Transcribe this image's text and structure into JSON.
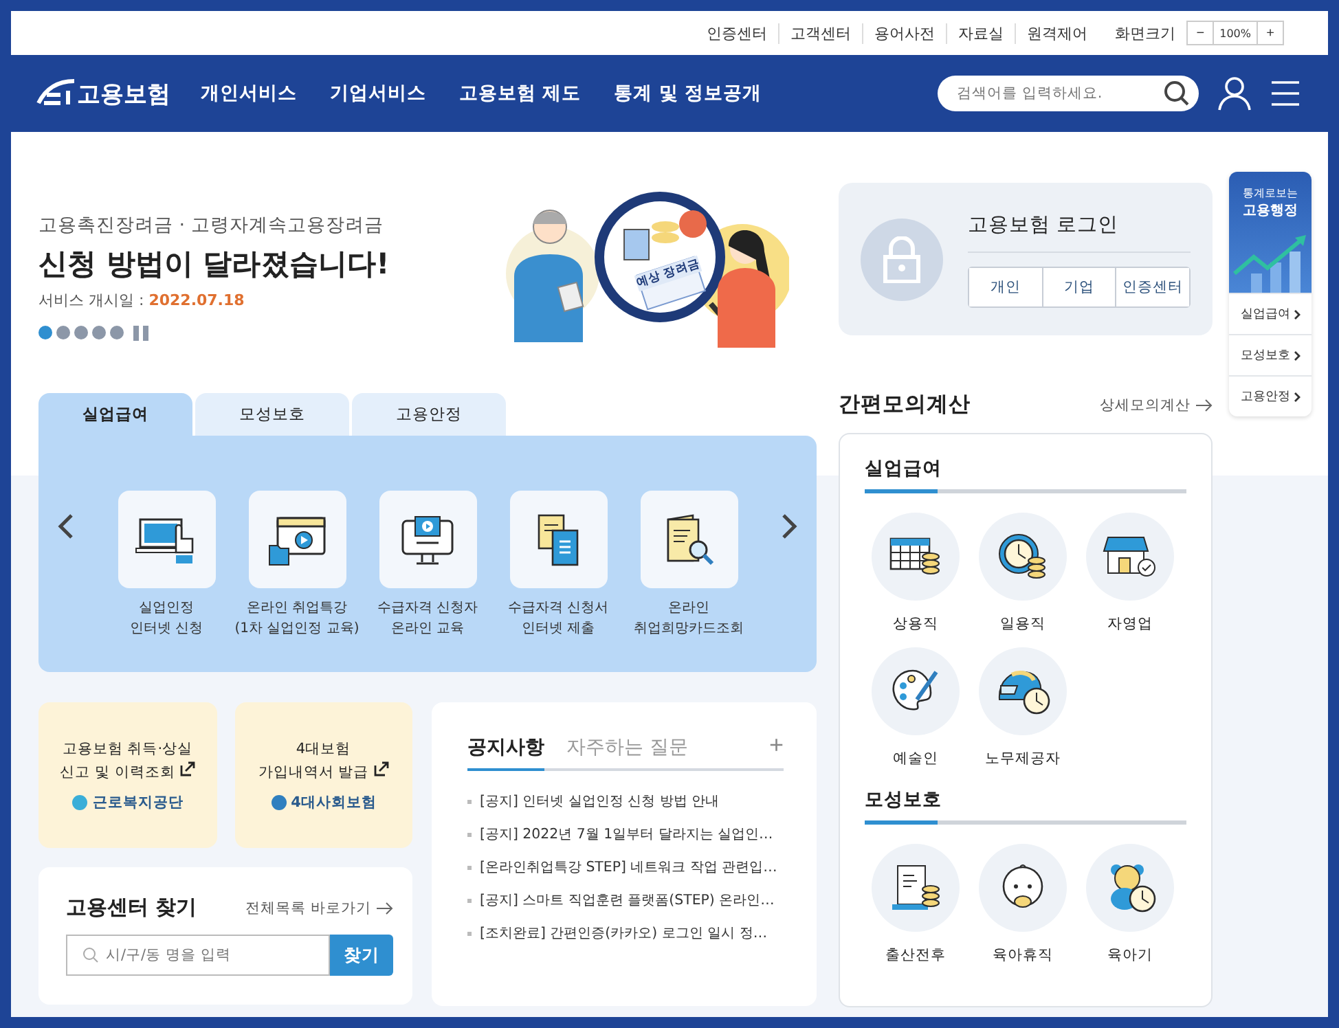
{
  "utility_links": [
    "인증센터",
    "고객센터",
    "용어사전",
    "자료실",
    "원격제어"
  ],
  "zoom": {
    "label": "화면크기",
    "minus": "−",
    "value": "100%",
    "plus": "+"
  },
  "logo": {
    "text": "고용보험"
  },
  "nav": [
    "개인서비스",
    "기업서비스",
    "고용보험 제도",
    "통계 및 정보공개"
  ],
  "search": {
    "placeholder": "검색어를 입력하세요."
  },
  "hero": {
    "subtitle": "고용촉진장려금 · 고령자계속고용장려금",
    "title": "신청 방법이 달라졌습니다!",
    "date_label": "서비스 개시일 : ",
    "date": "2022.07.18",
    "badge": "예상 장려금",
    "slides": [
      {
        "selected": true
      },
      {
        "selected": false
      },
      {
        "selected": false
      },
      {
        "selected": false
      },
      {
        "selected": false
      }
    ]
  },
  "service_tabs": [
    {
      "label": "실업급여",
      "selected": true
    },
    {
      "label": "모성보호",
      "selected": false
    },
    {
      "label": "고용안정",
      "selected": false
    }
  ],
  "services": [
    {
      "line1": "실업인정",
      "line2": "인터넷 신청"
    },
    {
      "line1": "온라인 취업특강",
      "line2": "(1차 실업인정 교육)"
    },
    {
      "line1": "수급자격 신청자",
      "line2": "온라인 교육"
    },
    {
      "line1": "수급자격 신청서",
      "line2": "인터넷 제출"
    },
    {
      "line1": "온라인",
      "line2": "취업희망카드조회"
    }
  ],
  "quick_cards": [
    {
      "line1": "고용보험 취득·상실",
      "line2": "신고 및 이력조회",
      "org": "근로복지공단"
    },
    {
      "line1": "4대보험",
      "line2": "가입내역서 발급",
      "org": "4대사회보험"
    }
  ],
  "center_finder": {
    "title": "고용센터 찾기",
    "link": "전체목록 바로가기",
    "placeholder": "시/구/동 명을 입력",
    "button": "찾기"
  },
  "notice": {
    "tabs": [
      {
        "label": "공지사항",
        "selected": true
      },
      {
        "label": "자주하는 질문",
        "selected": false
      }
    ],
    "more": "+",
    "items": [
      "[공지] 인터넷 실업인정 신청 방법 안내",
      "[공지] 2022년 7월 1일부터 달라지는 실업인…",
      "[온라인취업특강 STEP] 네트워크 작업 관련입…",
      "[공지] 스마트 직업훈련 플랫폼(STEP) 온라인…",
      "[조치완료] 간편인증(카카오) 로그인 일시 정…"
    ]
  },
  "login": {
    "title": "고용보험 로그인",
    "buttons": [
      "개인",
      "기업",
      "인증센터"
    ]
  },
  "calculator": {
    "title": "간편모의계산",
    "link": "상세모의계산",
    "sections": [
      {
        "title": "실업급여",
        "items": [
          "상용직",
          "일용직",
          "자영업",
          "예술인",
          "노무제공자"
        ]
      },
      {
        "title": "모성보호",
        "items": [
          "출산전후",
          "육아휴직",
          "육아기"
        ]
      }
    ]
  },
  "stats_widget": {
    "line1": "통계로보는",
    "line2": "고용행정",
    "links": [
      "실업급여",
      "모성보호",
      "고용안정"
    ]
  }
}
